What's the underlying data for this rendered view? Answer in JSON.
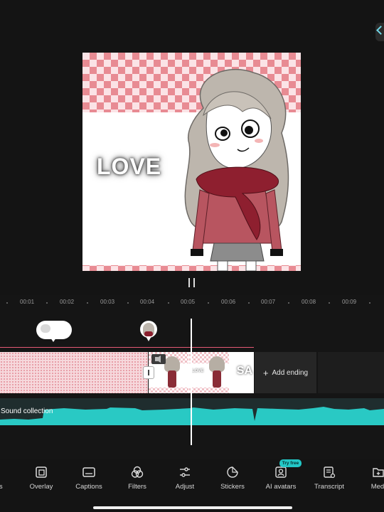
{
  "preview": {
    "overlay_text": "LOVE"
  },
  "ruler": {
    "labels": [
      "00:01",
      "00:02",
      "00:03",
      "00:04",
      "00:05",
      "00:06",
      "00:07",
      "00:08",
      "00:09"
    ]
  },
  "timeline": {
    "add_ending_label": "Add ending",
    "audio_label": "Sound collection",
    "clip_thumb_text": "LOVE",
    "clip_end_text": "SA"
  },
  "toolbar": {
    "items": [
      {
        "label": "ts",
        "icon": "text-icon"
      },
      {
        "label": "Overlay",
        "icon": "overlay-icon"
      },
      {
        "label": "Captions",
        "icon": "captions-icon"
      },
      {
        "label": "Filters",
        "icon": "filters-icon"
      },
      {
        "label": "Adjust",
        "icon": "adjust-icon"
      },
      {
        "label": "Stickers",
        "icon": "stickers-icon"
      },
      {
        "label": "AI avatars",
        "icon": "ai-avatar-icon"
      },
      {
        "label": "Transcript",
        "icon": "transcript-icon"
      },
      {
        "label": "Medi",
        "icon": "media-icon"
      }
    ],
    "try_free_badge": "Try free"
  },
  "colors": {
    "accent": "#22c7c6",
    "audio_wave": "#29c9c4",
    "selection_line": "#e65a75"
  }
}
